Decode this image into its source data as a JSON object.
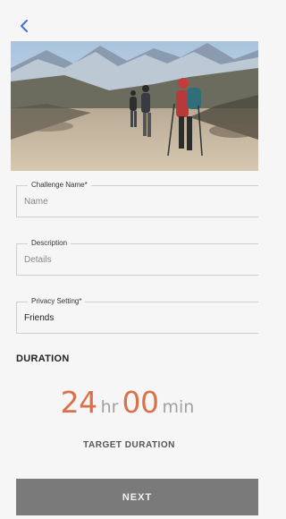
{
  "nav": {
    "back_icon": "chevron-left-icon"
  },
  "hero": {
    "image": "hikers-on-mountain-trail-photo"
  },
  "form": {
    "challenge_name": {
      "label": "Challenge Name*",
      "placeholder": "Name"
    },
    "description": {
      "label": "Description",
      "placeholder": "Details"
    },
    "privacy": {
      "label": "Privacy Setting*",
      "value": "Friends"
    }
  },
  "duration": {
    "title": "DURATION",
    "hours": "24",
    "hours_unit": "hr",
    "minutes": "00",
    "minutes_unit": "min",
    "caption": "TARGET DURATION"
  },
  "footer": {
    "next_label": "NEXT"
  },
  "colors": {
    "accent": "#d9714a",
    "back": "#3f6fd8",
    "button": "#7a7a7a"
  }
}
